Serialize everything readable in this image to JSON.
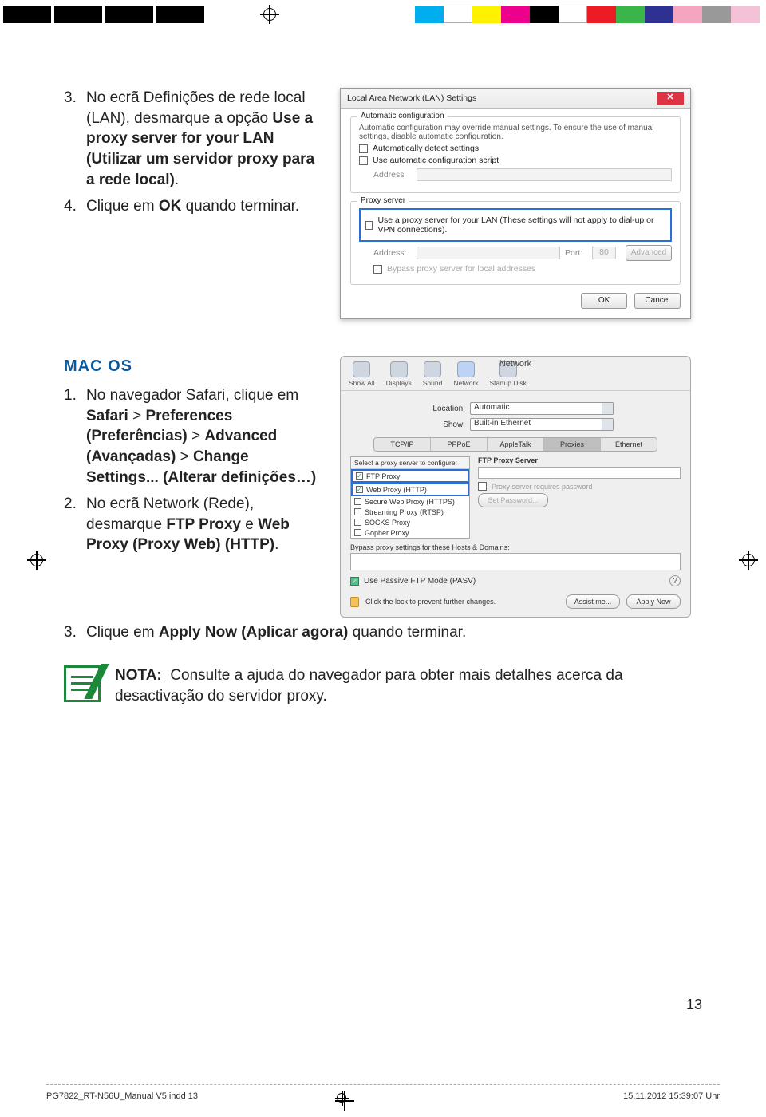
{
  "reg": {
    "cross": "⊕"
  },
  "steps_win": [
    {
      "n": "3.",
      "html": "No ecrã Definições de rede local (LAN), desmarque a opção <b>Use a proxy server for your LAN (Utilizar um servidor proxy para a rede local)</b>."
    },
    {
      "n": "4.",
      "html": "Clique em <b>OK</b> quando terminar."
    }
  ],
  "mac_heading": "MAC OS",
  "steps_mac": [
    {
      "n": "1.",
      "html": "No navegador Safari, clique em <b>Safari</b> > <b>Preferences (Preferências)</b> > <b>Advanced (Avançadas)</b> > <b>Change Settings... (Alterar definições…)</b>"
    },
    {
      "n": "2.",
      "html": "No ecrã Network (Rede), desmarque <b>FTP Proxy</b> e <b>Web Proxy (Proxy Web) (HTTP)</b>."
    },
    {
      "n": "3.",
      "html": "Clique em <b>Apply Now (Aplicar agora)</b> quando terminar."
    }
  ],
  "note": {
    "label": "NOTA:",
    "text": "Consulte a ajuda do navegador para obter mais detalhes acerca da desactivação do servidor proxy."
  },
  "win_dialog": {
    "title": "Local Area Network (LAN) Settings",
    "auto_legend": "Automatic configuration",
    "auto_desc": "Automatic configuration may override manual settings. To ensure the use of manual settings, disable automatic configuration.",
    "cb1": "Automatically detect settings",
    "cb2": "Use automatic configuration script",
    "addr_label": "Address",
    "proxy_legend": "Proxy server",
    "proxy_cb": "Use a proxy server for your LAN (These settings will not apply to dial-up or VPN connections).",
    "addr2": "Address:",
    "port": "Port:",
    "port_val": "80",
    "adv": "Advanced",
    "bypass": "Bypass proxy server for local addresses",
    "ok": "OK",
    "cancel": "Cancel"
  },
  "mac_dialog": {
    "title": "Network",
    "tb": [
      "Show All",
      "Displays",
      "Sound",
      "Network",
      "Startup Disk"
    ],
    "loc": "Location:",
    "loc_v": "Automatic",
    "show": "Show:",
    "show_v": "Built-in Ethernet",
    "tabs": [
      "TCP/IP",
      "PPPoE",
      "AppleTalk",
      "Proxies",
      "Ethernet"
    ],
    "list_hdr": "Select a proxy server to configure:",
    "items": [
      {
        "ck": true,
        "label": "FTP Proxy"
      },
      {
        "ck": true,
        "label": "Web Proxy (HTTP)"
      },
      {
        "ck": false,
        "label": "Secure Web Proxy (HTTPS)"
      },
      {
        "ck": false,
        "label": "Streaming Proxy (RTSP)"
      },
      {
        "ck": false,
        "label": "SOCKS Proxy"
      },
      {
        "ck": false,
        "label": "Gopher Proxy"
      }
    ],
    "right_hdr": "FTP Proxy Server",
    "req_pass": "Proxy server requires password",
    "set_pw": "Set Password...",
    "bypass": "Bypass proxy settings for these Hosts & Domains:",
    "pasv": "Use Passive FTP Mode (PASV)",
    "lock": "Click the lock to prevent further changes.",
    "assist": "Assist me...",
    "apply": "Apply Now"
  },
  "page_number": "13",
  "slug": {
    "file": "PG7822_RT-N56U_Manual V5.indd   13",
    "ts": "15.11.2012   15:39:07 Uhr"
  }
}
